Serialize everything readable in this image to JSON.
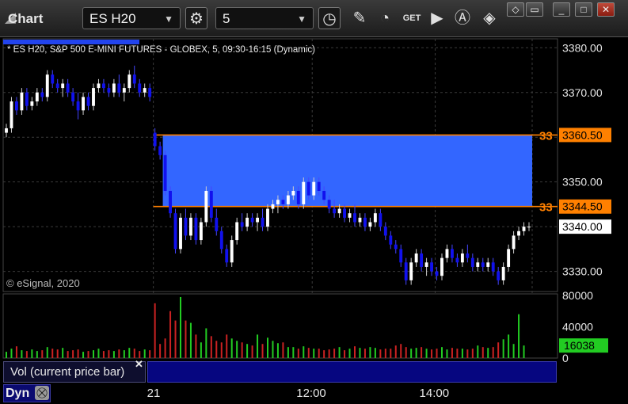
{
  "window": {
    "title": "Chart",
    "symbol": "ES H20",
    "interval": "5"
  },
  "toolbar_icons": [
    "settings-gear-icon",
    "clock-icon",
    "draw-pencil-icon",
    "study-curve-icon",
    "get-data-icon",
    "play-icon",
    "alert-icon",
    "tag-icon"
  ],
  "window_buttons": [
    "tag-icon",
    "restore-down-icon",
    "maximize-icon",
    "close-icon"
  ],
  "chart_data": {
    "type": "candlestick",
    "header": "* ES H20, S&P 500 E-MINI FUTURES - GLOBEX, 5, 09:30-16:15 (Dynamic)",
    "copyright": "© eSignal, 2020",
    "y_ticks": [
      "3380.00",
      "3370.00",
      "3360.00",
      "3350.00",
      "3340.00",
      "3330.00"
    ],
    "y_tick_values": [
      3380,
      3370,
      3360,
      3350,
      3340,
      3330
    ],
    "ylim": [
      3325.5,
      3382
    ],
    "x_ticks": [
      {
        "label": "21",
        "bar": 29
      },
      {
        "label": "12:00",
        "bar": 60
      },
      {
        "label": "14:00",
        "bar": 84
      }
    ],
    "session_break_bar": 29,
    "zone": {
      "low": 3344.5,
      "high": 3360.5,
      "start_bar": 31,
      "color": "#3366ff"
    },
    "level_lines": [
      {
        "value": 3360.5,
        "label": "3360.50",
        "left_label": "33",
        "color": "#ff8000"
      },
      {
        "value": 3344.5,
        "label": "3344.50",
        "left_label": "33",
        "color": "#ff8000"
      }
    ],
    "last_price": {
      "value": 3340.0,
      "label": "3340.00"
    },
    "candles": [
      [
        3361,
        3363,
        3360,
        3362
      ],
      [
        3362,
        3369,
        3361,
        3368
      ],
      [
        3368,
        3369,
        3365,
        3366
      ],
      [
        3366,
        3371,
        3365,
        3370
      ],
      [
        3370,
        3371,
        3366,
        3367
      ],
      [
        3367,
        3369,
        3366,
        3368
      ],
      [
        3368,
        3371,
        3367,
        3370
      ],
      [
        3370,
        3371,
        3368,
        3369
      ],
      [
        3369,
        3375,
        3368,
        3374
      ],
      [
        3374,
        3375,
        3371,
        3372
      ],
      [
        3372,
        3373,
        3370,
        3371
      ],
      [
        3371,
        3373,
        3369,
        3372
      ],
      [
        3372,
        3373,
        3369,
        3370
      ],
      [
        3370,
        3371,
        3367,
        3368
      ],
      [
        3368,
        3370,
        3364,
        3366
      ],
      [
        3366,
        3370,
        3365,
        3369
      ],
      [
        3369,
        3370,
        3366,
        3367
      ],
      [
        3367,
        3372,
        3366,
        3371
      ],
      [
        3371,
        3373,
        3370,
        3372
      ],
      [
        3372,
        3373,
        3370,
        3371
      ],
      [
        3371,
        3372,
        3369,
        3370
      ],
      [
        3370,
        3373,
        3369,
        3372
      ],
      [
        3372,
        3374,
        3369,
        3370
      ],
      [
        3370,
        3372,
        3368,
        3371
      ],
      [
        3371,
        3375,
        3370,
        3374
      ],
      [
        3374,
        3376,
        3371,
        3372
      ],
      [
        3372,
        3373,
        3369,
        3370
      ],
      [
        3370,
        3372,
        3369,
        3371
      ],
      [
        3371,
        3372,
        3368,
        3369
      ],
      [
        3361,
        3362,
        3357,
        3358
      ],
      [
        3358,
        3359,
        3355,
        3356
      ],
      [
        3356,
        3357,
        3347,
        3348
      ],
      [
        3348,
        3349,
        3342,
        3343
      ],
      [
        3343,
        3344,
        3334,
        3335
      ],
      [
        3335,
        3343,
        3334,
        3342
      ],
      [
        3342,
        3344,
        3337,
        3338
      ],
      [
        3338,
        3343,
        3337,
        3342
      ],
      [
        3342,
        3343,
        3336,
        3337
      ],
      [
        3337,
        3342,
        3336,
        3341
      ],
      [
        3341,
        3349,
        3340,
        3348
      ],
      [
        3348,
        3349,
        3341,
        3342
      ],
      [
        3342,
        3344,
        3338,
        3339
      ],
      [
        3339,
        3340,
        3334,
        3335
      ],
      [
        3335,
        3336,
        3331,
        3332
      ],
      [
        3332,
        3338,
        3331,
        3337
      ],
      [
        3337,
        3342,
        3336,
        3341
      ],
      [
        3341,
        3343,
        3339,
        3340
      ],
      [
        3340,
        3343,
        3339,
        3342
      ],
      [
        3342,
        3343,
        3340,
        3341
      ],
      [
        3341,
        3343,
        3339,
        3342
      ],
      [
        3342,
        3344,
        3339,
        3340
      ],
      [
        3340,
        3345,
        3339,
        3344
      ],
      [
        3344,
        3346,
        3343,
        3345
      ],
      [
        3345,
        3347,
        3343,
        3346
      ],
      [
        3346,
        3347,
        3344,
        3345
      ],
      [
        3345,
        3348,
        3344,
        3347
      ],
      [
        3347,
        3349,
        3346,
        3348
      ],
      [
        3348,
        3349,
        3344,
        3345
      ],
      [
        3345,
        3351,
        3344,
        3350
      ],
      [
        3350,
        3351,
        3346,
        3347
      ],
      [
        3347,
        3351,
        3346,
        3350
      ],
      [
        3350,
        3351,
        3347,
        3348
      ],
      [
        3348,
        3349,
        3345,
        3346
      ],
      [
        3346,
        3347,
        3343,
        3344
      ],
      [
        3344,
        3346,
        3342,
        3343
      ],
      [
        3343,
        3345,
        3342,
        3344
      ],
      [
        3344,
        3345,
        3341,
        3342
      ],
      [
        3342,
        3344,
        3341,
        3343
      ],
      [
        3343,
        3345,
        3340,
        3341
      ],
      [
        3341,
        3343,
        3340,
        3342
      ],
      [
        3342,
        3343,
        3339,
        3340
      ],
      [
        3340,
        3342,
        3339,
        3341
      ],
      [
        3341,
        3344,
        3340,
        3343
      ],
      [
        3343,
        3344,
        3339,
        3340
      ],
      [
        3340,
        3341,
        3337,
        3338
      ],
      [
        3338,
        3339,
        3335,
        3336
      ],
      [
        3336,
        3337,
        3334,
        3335
      ],
      [
        3335,
        3336,
        3331,
        3332
      ],
      [
        3332,
        3333,
        3327,
        3328
      ],
      [
        3328,
        3333,
        3327,
        3332
      ],
      [
        3332,
        3335,
        3331,
        3334
      ],
      [
        3334,
        3335,
        3330,
        3331
      ],
      [
        3331,
        3333,
        3329,
        3332
      ],
      [
        3332,
        3333,
        3329,
        3330
      ],
      [
        3330,
        3331,
        3328,
        3329
      ],
      [
        3329,
        3334,
        3328,
        3333
      ],
      [
        3333,
        3336,
        3332,
        3335
      ],
      [
        3335,
        3336,
        3332,
        3333
      ],
      [
        3333,
        3334,
        3331,
        3332
      ],
      [
        3332,
        3335,
        3331,
        3334
      ],
      [
        3334,
        3336,
        3332,
        3333
      ],
      [
        3333,
        3334,
        3330,
        3331
      ],
      [
        3331,
        3333,
        3330,
        3332
      ],
      [
        3332,
        3333,
        3330,
        3331
      ],
      [
        3331,
        3333,
        3330,
        3332
      ],
      [
        3332,
        3333,
        3329,
        3330
      ],
      [
        3330,
        3331,
        3327,
        3328
      ],
      [
        3328,
        3332,
        3327,
        3331
      ],
      [
        3331,
        3336,
        3330,
        3335
      ],
      [
        3335,
        3339,
        3334,
        3338
      ],
      [
        3338,
        3340,
        3337,
        3339
      ],
      [
        3339,
        3341,
        3338,
        3340
      ],
      [
        3340,
        3341,
        3339,
        3340
      ]
    ],
    "volume_panel": {
      "label": "Vol (current price bar)",
      "y_ticks": [
        "80000",
        "40000",
        "0"
      ],
      "y_tick_values": [
        80000,
        40000,
        0
      ],
      "ylim": [
        0,
        82000
      ],
      "current_value": 16038,
      "current_label": "16038",
      "up_color": "#22cc22",
      "down_color": "#cc2222",
      "values": [
        8000,
        12000,
        15000,
        10000,
        9000,
        11000,
        9000,
        10000,
        14000,
        12000,
        11000,
        13000,
        9000,
        10000,
        11000,
        8000,
        9000,
        10000,
        12000,
        9000,
        10000,
        9000,
        11000,
        10000,
        13000,
        12000,
        9000,
        11000,
        10000,
        70000,
        18000,
        25000,
        60000,
        48000,
        78000,
        48000,
        45000,
        30000,
        20000,
        38000,
        28000,
        22000,
        20000,
        30000,
        25000,
        22000,
        20000,
        18000,
        16000,
        30000,
        18000,
        26000,
        22000,
        19000,
        20000,
        14000,
        14000,
        12000,
        15000,
        13000,
        12000,
        12000,
        10000,
        11000,
        12000,
        14000,
        10000,
        12000,
        15000,
        13000,
        12000,
        14000,
        13000,
        11000,
        12000,
        12000,
        16000,
        18000,
        14000,
        12000,
        13000,
        14000,
        12000,
        11000,
        12000,
        14000,
        11000,
        13000,
        12000,
        12000,
        11000,
        12000,
        16000,
        14000,
        13000,
        14000,
        20000,
        24000,
        30000,
        18000,
        56000,
        16038
      ]
    }
  },
  "bottom": {
    "mode": "Dyn",
    "mode_icon": "lock-icon"
  }
}
